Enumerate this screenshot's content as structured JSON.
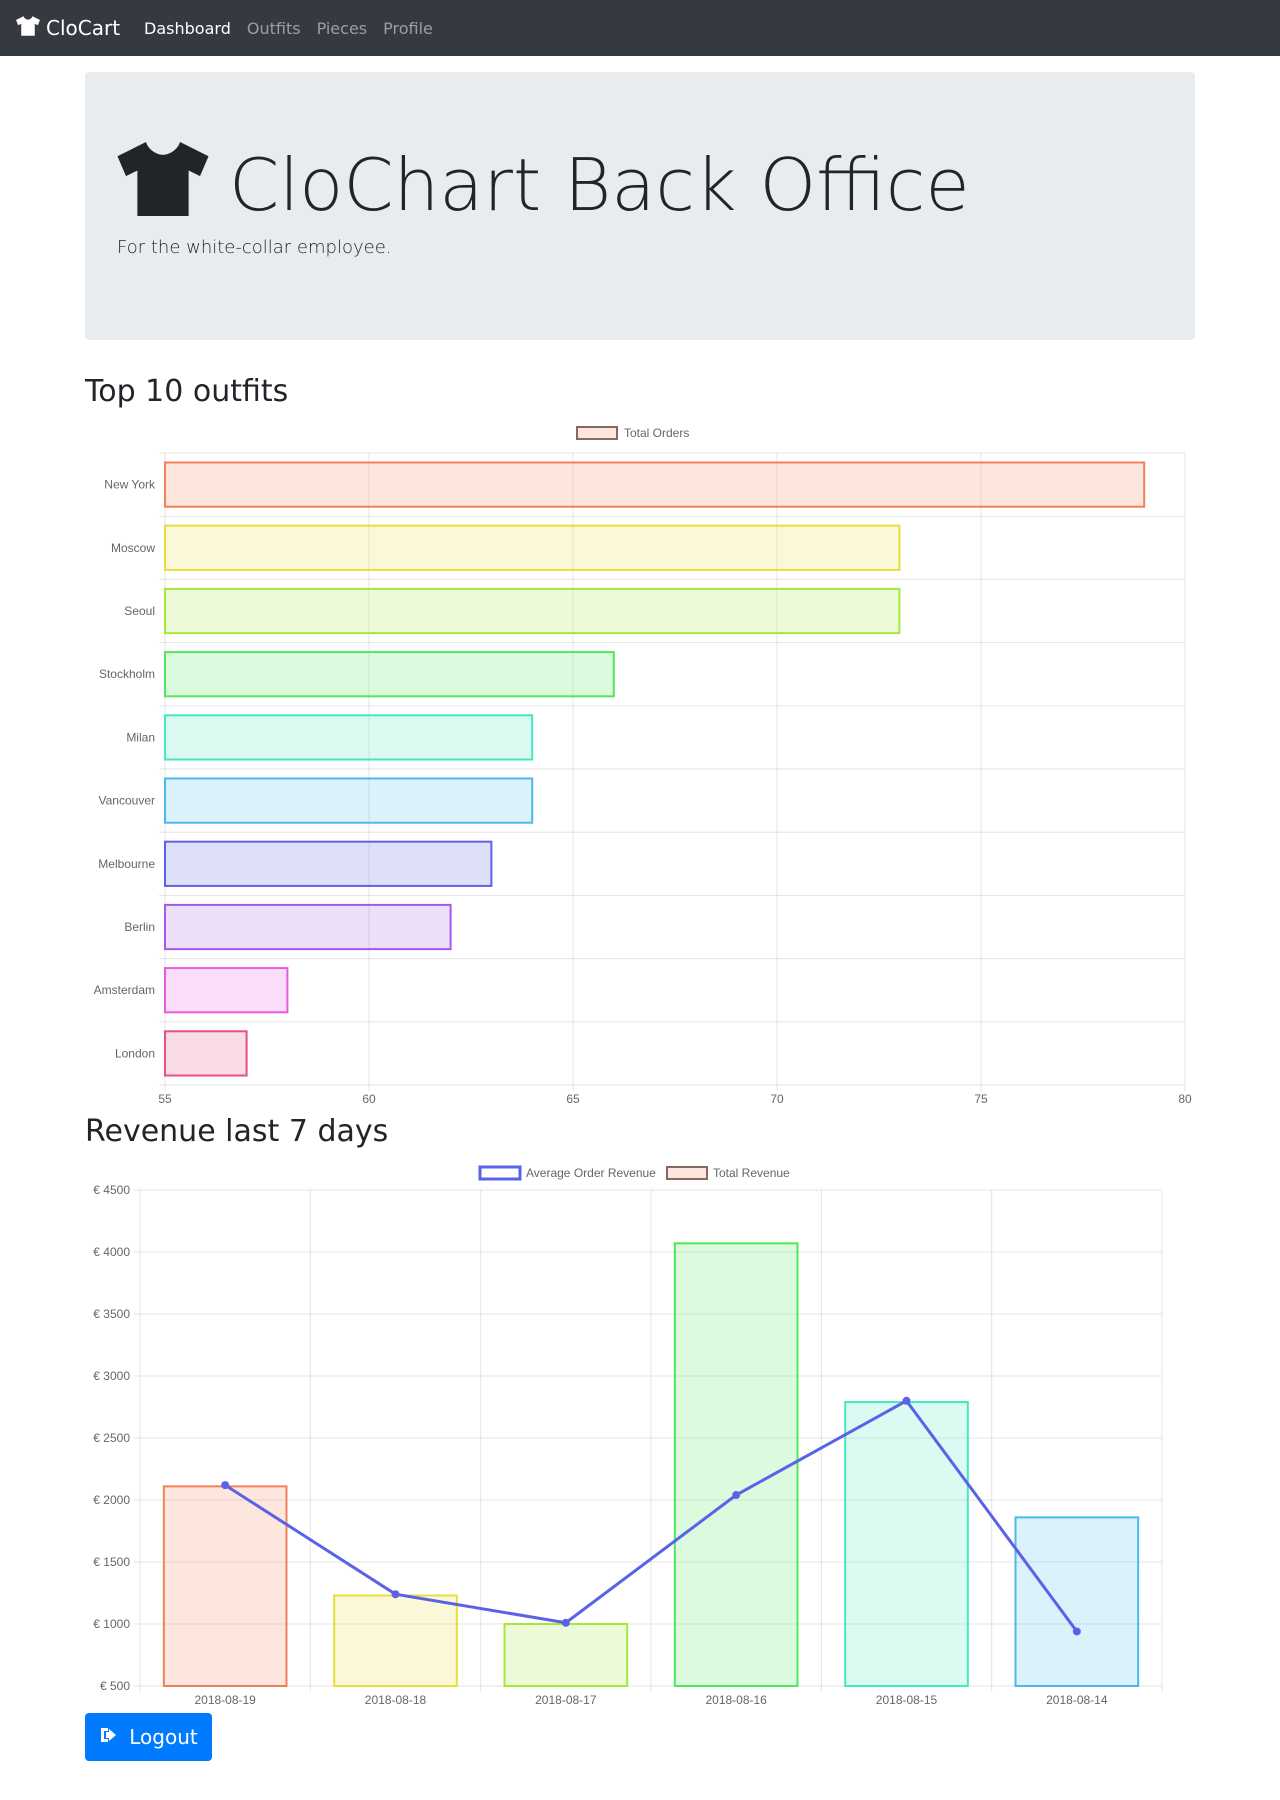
{
  "nav": {
    "brand": "CloCart",
    "links": [
      "Dashboard",
      "Outfits",
      "Pieces",
      "Profile"
    ],
    "active": 0
  },
  "hero": {
    "title": "CloChart Back Office",
    "subtitle": "For the white-collar employee."
  },
  "sections": {
    "outfits_title": "Top 10 outfits",
    "revenue_title": "Revenue last 7 days"
  },
  "logout_label": "Logout",
  "icons": {
    "brand": "tshirt-icon",
    "hero": "tshirt-icon",
    "logout": "sign-out-icon"
  },
  "chart_data": [
    {
      "type": "bar",
      "orientation": "horizontal",
      "categories": [
        "New York",
        "Moscow",
        "Seoul",
        "Stockholm",
        "Milan",
        "Vancouver",
        "Melbourne",
        "Berlin",
        "Amsterdam",
        "London"
      ],
      "series": [
        {
          "name": "Total Orders",
          "values": [
            79,
            73,
            73,
            66,
            64,
            64,
            63,
            62,
            58,
            57
          ]
        }
      ],
      "xlim": [
        55,
        80
      ],
      "xticks": [
        "55",
        "60",
        "65",
        "70",
        "75",
        "80"
      ],
      "legend": "top-center",
      "grid": true,
      "colors": [
        "#f0825a",
        "#e8dd3a",
        "#a4e83a",
        "#4fe85a",
        "#46e8c0",
        "#4cb9ea",
        "#5a63e8",
        "#a45ae8",
        "#e85ae0",
        "#e8507f"
      ]
    },
    {
      "type": "bar",
      "categories": [
        "2018-08-19",
        "2018-08-18",
        "2018-08-17",
        "2018-08-16",
        "2018-08-15",
        "2018-08-14"
      ],
      "series": [
        {
          "name": "Average Order Revenue",
          "type": "line",
          "values": [
            2120,
            1240,
            1010,
            2040,
            2800,
            940
          ]
        },
        {
          "name": "Total Revenue",
          "type": "bar",
          "values": [
            2110,
            1230,
            1000,
            4070,
            2790,
            1860
          ]
        }
      ],
      "ylim": [
        500,
        4500
      ],
      "yticks": [
        "€ 4500",
        "€ 4000",
        "€ 3500",
        "€ 3000",
        "€ 2500",
        "€ 2000",
        "€ 1500",
        "€ 1000",
        "€ 500"
      ],
      "legend": "top-center",
      "grid": true,
      "colors": [
        "#f0825a",
        "#e8dd3a",
        "#a4e83a",
        "#4fe85a",
        "#46e8c0",
        "#4cb9ea"
      ],
      "line_color": "#5a63e8"
    }
  ]
}
